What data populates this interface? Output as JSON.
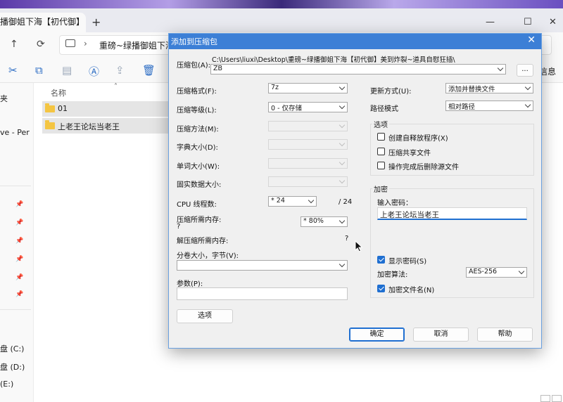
{
  "explorer": {
    "tab_title": "播御姐下海【初代御】",
    "new_tab": "+",
    "address_path": "重磅~绿播御姐下海",
    "toolbar_right": "信息",
    "sidebar": {
      "top_item": "夹",
      "mid_item": "ve - Per",
      "drive_c": "盘 (C:)",
      "drive_d": "盘 (D:)",
      "drive_e": "(E:)"
    },
    "column_header": "名称",
    "files": [
      {
        "name": "01"
      },
      {
        "name": "上老王论坛当老王"
      }
    ]
  },
  "dialog": {
    "title": "添加到压缩包",
    "archive_label": "压缩包(A):",
    "archive_path": "C:\\Users\\liuxi\\Desktop\\重磅~绿播御姐下海【初代御】美到炸裂~道具自慰狂插\\",
    "archive_name": "ZB",
    "browse_label": "...",
    "format_label": "压缩格式(F):",
    "format_value": "7z",
    "level_label": "压缩等级(L):",
    "level_value": "0 - 仅存储",
    "method_label": "压缩方法(M):",
    "dict_label": "字典大小(D):",
    "word_label": "单词大小(W):",
    "solid_label": "固实数据大小:",
    "cpu_label": "CPU 线程数:",
    "cpu_value": "24",
    "cpu_total": "/ 24",
    "mem_comp_label": "压缩所需内存:",
    "mem_comp_q": "?",
    "mem_value": "80%",
    "mem_decomp_label": "解压缩所需内存:",
    "mem_decomp_q": "?",
    "split_label": "分卷大小，字节(V):",
    "params_label": "参数(P):",
    "options_button": "选项",
    "update_label": "更新方式(U):",
    "update_value": "添加并替换文件",
    "path_mode_label": "路径模式",
    "path_mode_value": "相对路径",
    "options_group": "选项",
    "opt_sfx": "创建自释放程序(X)",
    "opt_shared": "压缩共享文件",
    "opt_delete": "操作完成后删除源文件",
    "encrypt_group": "加密",
    "password_label": "输入密码：",
    "password_value": "上老王论坛当老王",
    "show_password": "显示密码(S)",
    "enc_method_label": "加密算法:",
    "enc_method_value": "AES-256",
    "encrypt_names": "加密文件名(N)",
    "ok": "确定",
    "cancel": "取消",
    "help": "帮助"
  }
}
